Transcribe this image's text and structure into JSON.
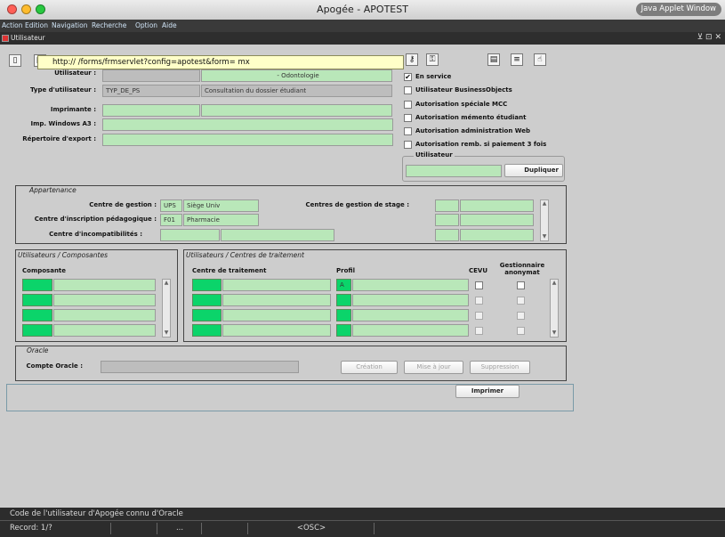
{
  "window": {
    "title": "Apogée - APOTEST",
    "java_badge": "Java Applet Window"
  },
  "menu": {
    "items": [
      "Action",
      "Edition",
      "Navigation",
      "Recherche",
      "Option",
      "Aide"
    ]
  },
  "document": {
    "tab_label": "Utilisateur"
  },
  "tooltip": {
    "url": "http://                                            /forms/frmservlet?config=apotest&form=              mx"
  },
  "utilisateur": {
    "label": "Utilisateur :",
    "name_suffix": "- Odontologie",
    "type_label": "Type d'utilisateur :",
    "type_code": "TYP_DE_PS",
    "type_desc": "Consultation du dossier étudiant",
    "imprimante_label": "Imprimante :",
    "windows_label": "Imp. Windows A3 :",
    "export_label": "Répertoire d'export :"
  },
  "options": {
    "items": [
      {
        "label": "En service",
        "checked": true
      },
      {
        "label": "Utilisateur BusinessObjects",
        "checked": false
      },
      {
        "label": "Autorisation spéciale MCC",
        "checked": false
      },
      {
        "label": "Autorisation mémento étudiant",
        "checked": false
      },
      {
        "label": "Autorisation administration Web",
        "checked": false
      },
      {
        "label": "Autorisation remb. si paiement 3 fois",
        "checked": false
      }
    ],
    "check_mark": "✔",
    "utilisateur_group": "Utilisateur",
    "dupliquer": "Dupliquer"
  },
  "appartenance": {
    "title": "Appartenance",
    "centre_gestion_label": "Centre de gestion :",
    "centre_gestion_code": "UPS",
    "centre_gestion_name": "Siège Univ",
    "centre_inscription_label": "Centre d'inscription pédagogique :",
    "centre_inscription_code": "F01",
    "centre_inscription_name": "Pharmacie",
    "centre_incompat_label": "Centre d'incompatibilités :",
    "centres_stage_label": "Centres de gestion de stage :"
  },
  "composantes": {
    "title": "Utilisateurs / Composantes",
    "col_header": "Composante"
  },
  "centres_traitement": {
    "title": "Utilisateurs / Centres de traitement",
    "col_centre": "Centre de traitement",
    "col_profil": "Profil",
    "col_cevu": "CEVU",
    "col_gest": "Gestionnaire anonymat",
    "first_profil": "A"
  },
  "oracle": {
    "title": "Oracle",
    "compte_label": "Compte Oracle :",
    "creation": "Création",
    "mise_a_jour": "Mise à jour",
    "suppression": "Suppression"
  },
  "imprimer": "Imprimer",
  "status": {
    "message": "Code de l'utilisateur d'Apogée connu d'Oracle",
    "record": "Record: 1/?",
    "ellipsis": "...",
    "osc": "<OSC>"
  }
}
